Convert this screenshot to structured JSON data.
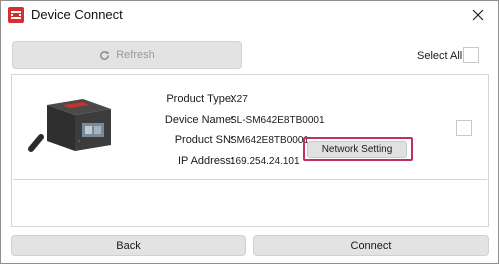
{
  "window": {
    "title": "Device Connect",
    "app_icon": "app-logo-icon",
    "close_icon": "close-icon"
  },
  "toolbar": {
    "refresh_label": "Refresh",
    "refresh_icon": "refresh-icon",
    "select_all_label": "Select All"
  },
  "devices": [
    {
      "fields": [
        {
          "label": "Product Type:",
          "value": "X27"
        },
        {
          "label": "Device Name:",
          "value": "SL-SM642E8TB0001"
        },
        {
          "label": "Product SN:",
          "value": "SM642E8TB0001"
        },
        {
          "label": "IP Address:",
          "value": "169.254.24.101"
        }
      ],
      "network_setting_label": "Network Setting",
      "image": "barcode-scanner-device"
    }
  ],
  "footer": {
    "back_label": "Back",
    "connect_label": "Connect"
  },
  "colors": {
    "accent_highlight": "#c03060",
    "app_icon_red": "#d62f2f",
    "button_gray": "#e3e3e3"
  }
}
